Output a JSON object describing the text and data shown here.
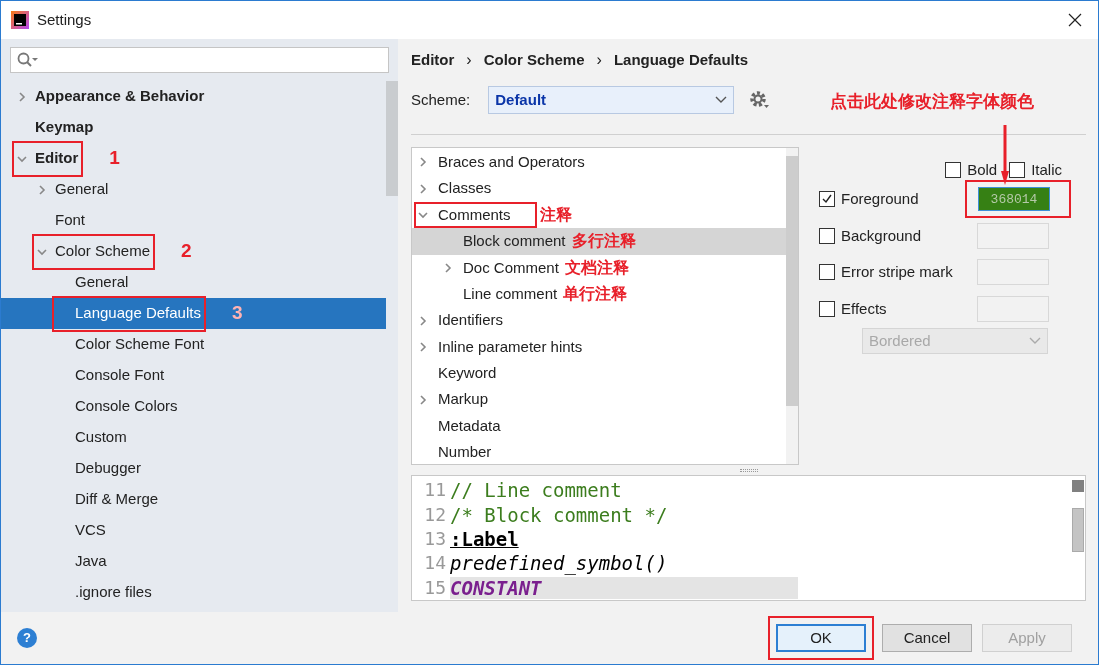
{
  "window": {
    "title": "Settings"
  },
  "sidebar": {
    "items": [
      {
        "label": "Appearance & Behavior",
        "bold": true,
        "expanded": false,
        "selected": false
      },
      {
        "label": "Keymap",
        "bold": true,
        "selected": false
      },
      {
        "label": "Editor",
        "bold": true,
        "expanded": true,
        "selected": false,
        "callout": "1",
        "children": [
          {
            "label": "General",
            "expanded": false,
            "selected": false
          },
          {
            "label": "Font",
            "selected": false
          },
          {
            "label": "Color Scheme",
            "expanded": true,
            "selected": false,
            "callout": "2",
            "children": [
              {
                "label": "General",
                "selected": false
              },
              {
                "label": "Language Defaults",
                "selected": true,
                "callout": "3"
              },
              {
                "label": "Color Scheme Font",
                "selected": false
              },
              {
                "label": "Console Font",
                "selected": false
              },
              {
                "label": "Console Colors",
                "selected": false
              },
              {
                "label": "Custom",
                "selected": false
              },
              {
                "label": "Debugger",
                "selected": false
              },
              {
                "label": "Diff & Merge",
                "selected": false
              },
              {
                "label": "VCS",
                "selected": false
              },
              {
                "label": "Java",
                "selected": false
              },
              {
                "label": ".ignore files",
                "selected": false
              }
            ]
          }
        ]
      }
    ]
  },
  "breadcrumb": [
    "Editor",
    "›",
    "Color Scheme",
    "›",
    "Language Defaults"
  ],
  "scheme": {
    "label": "Scheme:",
    "value": "Default"
  },
  "tip": "点击此处修改注释字体颜色",
  "tree": [
    {
      "label": "Braces and Operators",
      "expanded": false,
      "selected": false
    },
    {
      "label": "Classes",
      "expanded": false,
      "selected": false
    },
    {
      "label": "Comments",
      "expanded": true,
      "selected": false,
      "boxed": true,
      "note": "注释",
      "children": [
        {
          "label": "Block comment",
          "selected": true,
          "note": "多行注释"
        },
        {
          "label": "Doc Comment",
          "expanded": false,
          "selected": false,
          "note": "文档注释"
        },
        {
          "label": "Line comment",
          "selected": false,
          "note": "单行注释"
        }
      ]
    },
    {
      "label": "Identifiers",
      "expanded": false,
      "selected": false
    },
    {
      "label": "Inline parameter hints",
      "expanded": false,
      "selected": false
    },
    {
      "label": "Keyword",
      "selected": false
    },
    {
      "label": "Markup",
      "expanded": false,
      "selected": false
    },
    {
      "label": "Metadata",
      "selected": false
    },
    {
      "label": "Number",
      "selected": false
    }
  ],
  "attributes": {
    "bold": {
      "label": "Bold",
      "checked": false
    },
    "italic": {
      "label": "Italic",
      "checked": false
    },
    "rows": [
      {
        "label": "Foreground",
        "checked": true,
        "value": "368014",
        "color": "#368014",
        "boxed": true
      },
      {
        "label": "Background",
        "checked": false
      },
      {
        "label": "Error stripe mark",
        "checked": false
      },
      {
        "label": "Effects",
        "checked": false
      }
    ],
    "effect": {
      "value": "Bordered",
      "disabled": true
    }
  },
  "preview": [
    {
      "number": "11",
      "text": "// Line comment",
      "kind": "comment"
    },
    {
      "number": "12",
      "text": "/* Block comment */",
      "kind": "comment"
    },
    {
      "number": "13",
      "text": ":Label",
      "kind": "label"
    },
    {
      "number": "14",
      "text": "predefined_symbol()",
      "kind": "italic"
    },
    {
      "number": "15",
      "text": "CONSTANT",
      "kind": "constant"
    }
  ],
  "buttons": [
    {
      "label": "OK",
      "default": true,
      "disabled": false
    },
    {
      "label": "Cancel",
      "default": false,
      "disabled": false
    },
    {
      "label": "Apply",
      "default": false,
      "disabled": true
    }
  ],
  "help": "?"
}
